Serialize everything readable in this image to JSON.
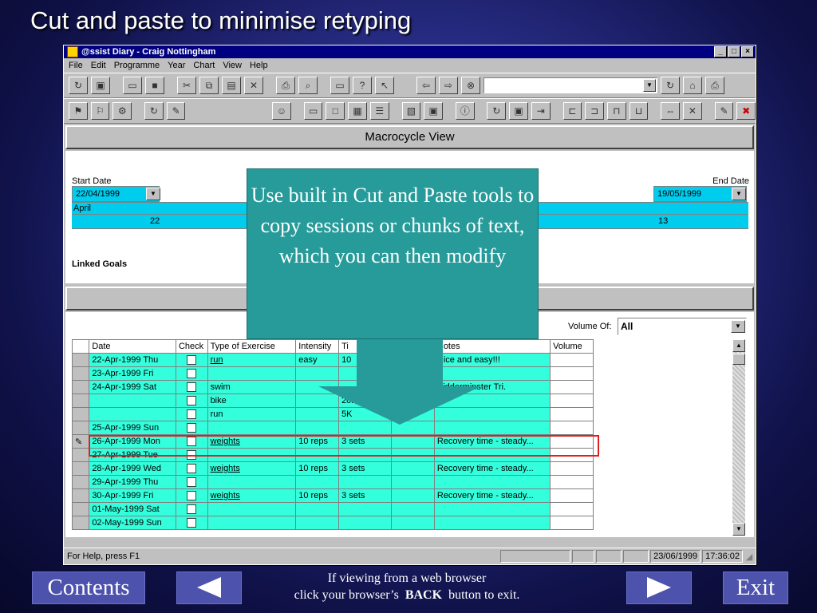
{
  "slide": {
    "title": "Cut and paste to minimise retyping"
  },
  "window": {
    "title": "@ssist Diary - Craig Nottingham",
    "controls": [
      "_",
      "□",
      "×"
    ],
    "menu": [
      "File",
      "Edit",
      "Programme",
      "Year",
      "Chart",
      "View",
      "Help"
    ]
  },
  "macro": {
    "header": "Macrocycle View",
    "start_date_label": "Start Date",
    "start_date": "22/04/1999",
    "end_date_label": "End Date",
    "end_date": "19/05/1999",
    "month": "April",
    "week_start": "22",
    "week_end": "13",
    "linked_goals": "Linked Goals"
  },
  "grid": {
    "volume_label": "Volume Of:",
    "volume_value": "All",
    "columns": [
      "Date",
      "Check",
      "Type of Exercise",
      "Intensity",
      "Ti",
      "",
      "Notes",
      "Volume"
    ],
    "rows": [
      {
        "marker": "",
        "date": "22-Apr-1999 Thu",
        "type": "run",
        "type_link": true,
        "intensity": "easy",
        "time": "10",
        "notes": "Nice and easy!!!"
      },
      {
        "marker": "",
        "date": "23-Apr-1999 Fri",
        "type": "",
        "type_link": false,
        "intensity": "",
        "time": "",
        "notes": ""
      },
      {
        "marker": "",
        "date": "24-Apr-1999 Sat",
        "type": "swim",
        "type_link": false,
        "intensity": "",
        "time": "",
        "notes": "Kidderminster Tri."
      },
      {
        "marker": "",
        "date": "",
        "type": "bike",
        "type_link": false,
        "intensity": "",
        "time": "20k",
        "notes": ""
      },
      {
        "marker": "",
        "date": "",
        "type": "run",
        "type_link": false,
        "intensity": "",
        "time": "5K",
        "notes": ""
      },
      {
        "marker": "",
        "date": "25-Apr-1999 Sun",
        "type": "",
        "type_link": false,
        "intensity": "",
        "time": "",
        "notes": ""
      },
      {
        "marker": "✎",
        "date": "26-Apr-1999 Mon",
        "type": "weights",
        "type_link": true,
        "intensity": "10 reps",
        "time": "3 sets",
        "notes": "Recovery time - steady..."
      },
      {
        "marker": "",
        "date": "27-Apr-1999 Tue",
        "type": "",
        "type_link": false,
        "intensity": "",
        "time": "",
        "notes": ""
      },
      {
        "marker": "",
        "date": "28-Apr-1999 Wed",
        "type": "weights",
        "type_link": true,
        "intensity": "10 reps",
        "time": "3 sets",
        "notes": "Recovery time - steady..."
      },
      {
        "marker": "",
        "date": "29-Apr-1999 Thu",
        "type": "",
        "type_link": false,
        "intensity": "",
        "time": "",
        "notes": ""
      },
      {
        "marker": "",
        "date": "30-Apr-1999 Fri",
        "type": "weights",
        "type_link": true,
        "intensity": "10 reps",
        "time": "3 sets",
        "notes": "Recovery time - steady..."
      },
      {
        "marker": "",
        "date": "01-May-1999 Sat",
        "type": "",
        "type_link": false,
        "intensity": "",
        "time": "",
        "notes": ""
      },
      {
        "marker": "",
        "date": "02-May-1999 Sun",
        "type": "",
        "type_link": false,
        "intensity": "",
        "time": "",
        "notes": ""
      }
    ]
  },
  "status": {
    "help": "For Help, press F1",
    "date": "23/06/1999",
    "time": "17:36:02"
  },
  "callout": {
    "text": "Use built in Cut and Paste tools to copy sessions or chunks of text, which you can then modify"
  },
  "nav": {
    "contents": "Contents",
    "exit": "Exit",
    "footer_line1": "If viewing from a web browser",
    "footer_line2_a": "click your browser’s",
    "footer_line2_b": "BACK",
    "footer_line2_c": "button to exit."
  }
}
